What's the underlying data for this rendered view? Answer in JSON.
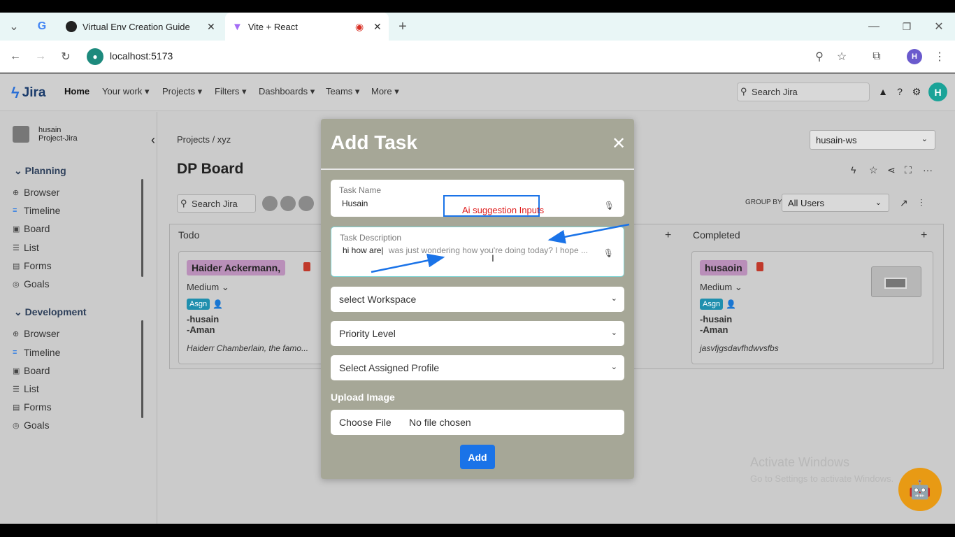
{
  "browser": {
    "tabs": [
      {
        "title": "Virtual Env Creation Guide"
      },
      {
        "title": "Vite + React"
      }
    ],
    "url": "localhost:5173",
    "profile_initial": "H"
  },
  "app": {
    "logo_text": "Jira",
    "nav": {
      "home": "Home",
      "your_work": "Your work",
      "projects": "Projects",
      "filters": "Filters",
      "dashboards": "Dashboards",
      "teams": "Teams",
      "more": "More"
    },
    "search_placeholder": "Search Jira",
    "user_initial": "H"
  },
  "sidebar": {
    "user_name": "husain",
    "project_name": "Project-Jira",
    "sections": [
      {
        "title": "Planning",
        "items": [
          "Browser",
          "Timeline",
          "Board",
          "List",
          "Forms",
          "Goals"
        ]
      },
      {
        "title": "Development",
        "items": [
          "Browser",
          "Timeline",
          "Board",
          "List",
          "Forms",
          "Goals"
        ]
      }
    ]
  },
  "board": {
    "breadcrumb": "Projects / xyz",
    "title": "DP Board",
    "workspace": "husain-ws",
    "search_placeholder": "Search Jira",
    "group_by_label": "GROUP BY",
    "group_by_value": "All Users",
    "columns": {
      "todo": "Todo",
      "completed": "Completed"
    },
    "cards": [
      {
        "name": "Haider Ackermann,",
        "priority": "Medium",
        "assign_badge": "Asgn",
        "assignees": [
          "-husain",
          "-Aman"
        ],
        "description": "Haiderr Chamberlain, the famo..."
      },
      {
        "name": "husaoin",
        "priority": "Medium",
        "assign_badge": "Asgn",
        "assignees": [
          "-husain",
          "-Aman"
        ],
        "description": "jasvfjgsdavfhdwvsfbs"
      }
    ]
  },
  "modal": {
    "title": "Add Task",
    "task_name_label": "Task Name",
    "task_name_value": "Husain",
    "task_desc_label": "Task Description",
    "task_desc_typed": "hi how are",
    "task_desc_suggestion": "was just wondering how you're doing today? I hope ...",
    "workspace_placeholder": "select Workspace",
    "priority_placeholder": "Priority Level",
    "profile_placeholder": "Select Assigned Profile",
    "upload_label": "Upload Image",
    "choose_file": "Choose File",
    "no_file": "No file chosen",
    "add_button": "Add"
  },
  "annotation": {
    "text": "Ai suggestion Inputs",
    "color": "#e01b1b",
    "arrow_color": "#1a73e8"
  },
  "watermark": {
    "line1": "Activate Windows",
    "line2": "Go to Settings to activate Windows."
  },
  "colors": {
    "modal_bg": "#a6a797",
    "primary": "#1a73e8",
    "asgn_badge": "#1f8fae",
    "name_pill": "#b98fb9",
    "chatbot": "#e89a14"
  }
}
